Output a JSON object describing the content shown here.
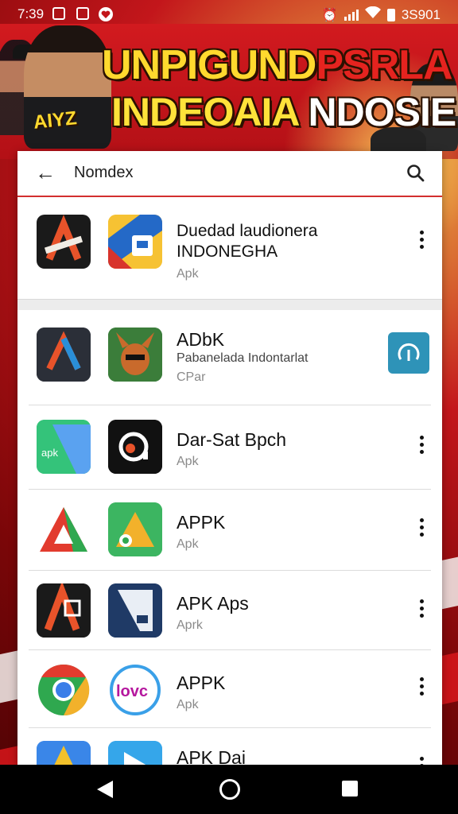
{
  "status_bar": {
    "time": "7:39",
    "right_text": "3S901",
    "icons": [
      "image-icon",
      "notification-icon",
      "heart-icon",
      "alarm-icon",
      "signal-icon",
      "wifi-icon",
      "battery-icon"
    ]
  },
  "banner": {
    "headline_line1_a": "UNPIGUND",
    "headline_line1_b": "PSRLA",
    "headline_line2_a": "INDEOAIA",
    "headline_line2_b": "NDOSIE",
    "side_badge": "AIYZ"
  },
  "search": {
    "query": "Nomdex",
    "back_icon": "arrow-left-icon",
    "search_icon": "search-icon"
  },
  "featured": {
    "title_line1": "Duedad laudionera",
    "title_line2": "INDONEGHA",
    "subtitle": "Apk"
  },
  "results": [
    {
      "title": "ADbK",
      "sub1": "Pabanelada Indontarlat",
      "sub2": "CPar",
      "action": "install"
    },
    {
      "title": "Dar-Sat Bpch",
      "sub1": "Apk",
      "action": "menu"
    },
    {
      "title": "APPK",
      "sub1": "Apk",
      "action": "menu"
    },
    {
      "title": "APK Aps",
      "sub1": "Aprk",
      "action": "menu"
    },
    {
      "title": "APPK",
      "sub1": "Apk",
      "action": "menu"
    },
    {
      "title": "APK Dai",
      "sub1": "",
      "action": "menu"
    }
  ],
  "icon_labels": {
    "result2_icon1": "apk",
    "result5_icon2": "lovc"
  },
  "colors": {
    "accent_red": "#d32f2f",
    "install_button": "#2e93b8",
    "headline_yellow": "#ffd92e"
  },
  "navbar": {
    "icons": [
      "nav-back-icon",
      "nav-home-icon",
      "nav-recents-icon"
    ]
  }
}
